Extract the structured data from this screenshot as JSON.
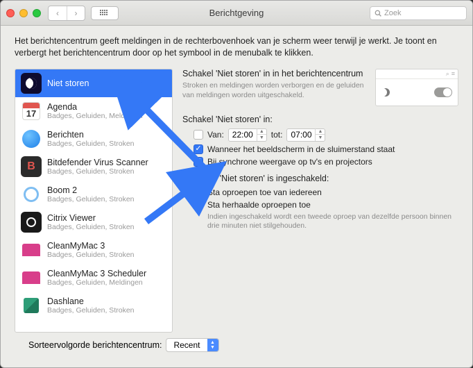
{
  "window": {
    "title": "Berichtgeving"
  },
  "search": {
    "placeholder": "Zoek"
  },
  "description": "Het berichtencentrum geeft meldingen in de rechterbovenhoek van je scherm weer terwijl je werkt. Je toont en verbergt het berichtencentrum door op het symbool in de menubalk te klikken.",
  "sidebar": {
    "selected": 0,
    "items": [
      {
        "name": "Niet storen",
        "sub": ""
      },
      {
        "name": "Agenda",
        "sub": "Badges, Geluiden, Meldingen"
      },
      {
        "name": "Berichten",
        "sub": "Badges, Geluiden, Stroken"
      },
      {
        "name": "Bitdefender Virus Scanner",
        "sub": "Badges, Geluiden, Stroken"
      },
      {
        "name": "Boom 2",
        "sub": "Badges, Geluiden, Stroken"
      },
      {
        "name": "Citrix Viewer",
        "sub": "Badges, Geluiden, Stroken"
      },
      {
        "name": "CleanMyMac 3",
        "sub": "Badges, Geluiden, Stroken"
      },
      {
        "name": "CleanMyMac 3 Scheduler",
        "sub": "Badges, Geluiden, Meldingen"
      },
      {
        "name": "Dashlane",
        "sub": "Badges, Geluiden, Stroken"
      }
    ]
  },
  "panel": {
    "header_title": "Schakel 'Niet storen' in in het berichtencentrum",
    "header_desc": "Stroken en meldingen worden verborgen en de geluiden van meldingen worden uitgeschakeld.",
    "schedule_section": "Schakel 'Niet storen' in:",
    "from_label": "Van:",
    "from_time": "22:00",
    "to_label": "tot:",
    "to_time": "07:00",
    "check_sleep": "Wanneer het beeldscherm in de sluimerstand staat",
    "check_tv": "Bij synchrone weergave op tv's en projectors",
    "when_on_section": "Wanneer 'Niet storen' is ingeschakeld:",
    "allow_calls": "Sta oproepen toe van iedereen",
    "allow_repeat": "Sta herhaalde oproepen toe",
    "repeat_note": "Indien ingeschakeld wordt een tweede oproep van dezelfde persoon binnen drie minuten niet stilgehouden."
  },
  "footer": {
    "label": "Sorteervolgorde berichtencentrum:",
    "value": "Recent"
  },
  "colors": {
    "accent": "#3478f6"
  }
}
